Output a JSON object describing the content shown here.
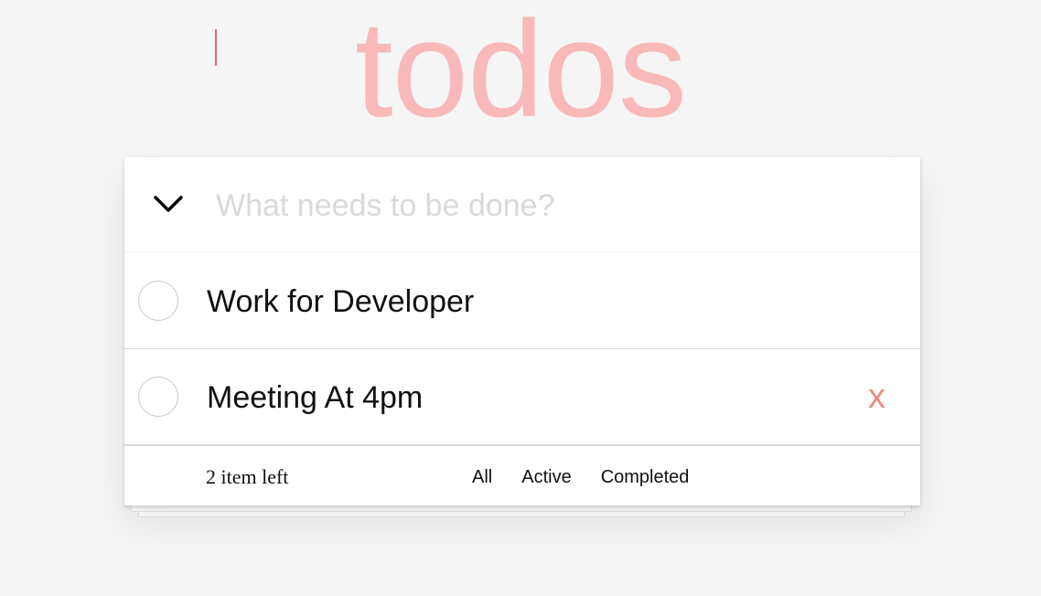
{
  "app": {
    "title": "todos"
  },
  "new_todo": {
    "placeholder": "What needs to be done?",
    "value": ""
  },
  "todos": [
    {
      "label": "Work for Developer",
      "completed": false
    },
    {
      "label": "Meeting At 4pm",
      "completed": false,
      "destroy_label": "x"
    }
  ],
  "footer": {
    "count_text": "2 item left",
    "filters": [
      "All",
      "Active",
      "Completed"
    ]
  },
  "colors": {
    "title": "#f9b9b9",
    "destroy": "#f08a85",
    "background": "#f5f5f5"
  },
  "icons": {
    "toggle_all": "chevron-down-icon"
  }
}
